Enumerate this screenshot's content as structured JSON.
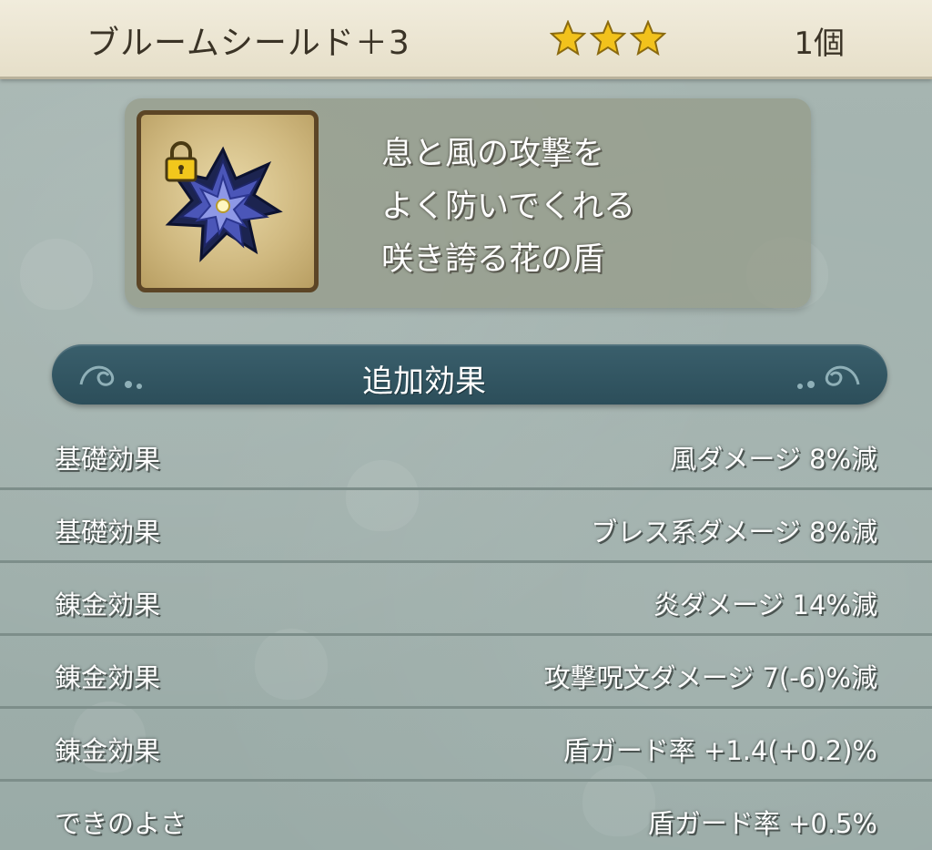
{
  "header": {
    "item_name": "ブルームシールド＋3",
    "rarity_stars": 3,
    "count": "1個"
  },
  "item": {
    "icon": "bloom-shield-icon",
    "locked": true,
    "description_lines": [
      "息と風の攻撃を",
      "よく防いでくれる",
      "咲き誇る花の盾"
    ]
  },
  "section": {
    "title": "追加効果"
  },
  "effects": [
    {
      "label": "基礎効果",
      "value": "風ダメージ  8%減"
    },
    {
      "label": "基礎効果",
      "value": "ブレス系ダメージ  8%減"
    },
    {
      "label": "錬金効果",
      "value": "炎ダメージ  14%減"
    },
    {
      "label": "錬金効果",
      "value": "攻撃呪文ダメージ  7(-6)%減"
    },
    {
      "label": "錬金効果",
      "value": "盾ガード率  +1.4(+0.2)%"
    },
    {
      "label": "できのよさ",
      "value": "盾ガード率  +0.5%"
    }
  ],
  "colors": {
    "header_bg": "#ece6d3",
    "star": "#f2c21c",
    "banner": "#33576a",
    "background": "#9eaeaa"
  }
}
